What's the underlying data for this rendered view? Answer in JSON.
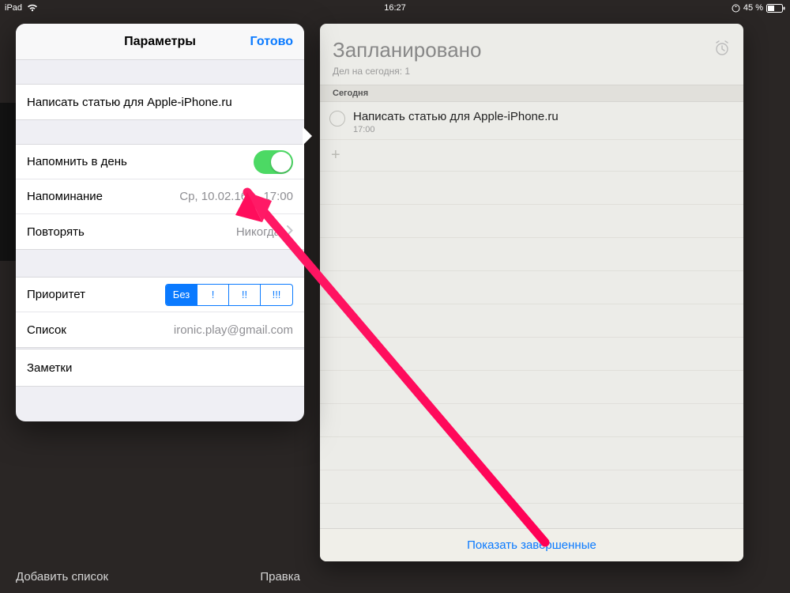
{
  "statusbar": {
    "device": "iPad",
    "time": "16:27",
    "battery_text": "45 %"
  },
  "popover": {
    "title": "Параметры",
    "done": "Готово",
    "reminder_title": "Написать статью для Apple-iPhone.ru",
    "remind_on_day": "Напомнить в день",
    "remind_label": "Напоминание",
    "remind_value": "Ср, 10.02.16 г., 17:00",
    "repeat_label": "Повторять",
    "repeat_value": "Никогда",
    "priority_label": "Приоритет",
    "priority_segments": [
      "Без",
      "!",
      "!!",
      "!!!"
    ],
    "priority_selected": 0,
    "list_label": "Список",
    "list_value": "ironic.play@gmail.com",
    "notes_label": "Заметки"
  },
  "main": {
    "title": "Запланировано",
    "subtitle": "Дел на сегодня: 1",
    "section": "Сегодня",
    "item_title": "Написать статью для Apple-iPhone.ru",
    "item_time": "17:00",
    "footer": "Показать завершенные"
  },
  "bottom": {
    "add_list": "Добавить список",
    "edit": "Правка"
  }
}
